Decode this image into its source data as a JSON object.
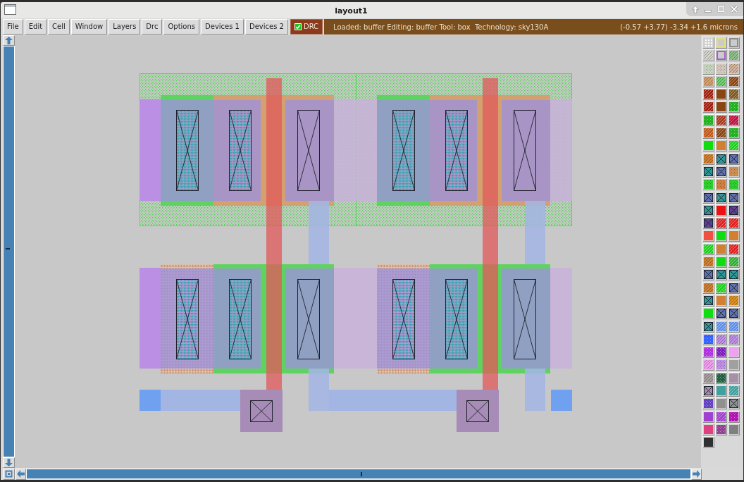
{
  "window": {
    "title": "layout1"
  },
  "menu_bar": [
    "File",
    "Edit",
    "Cell",
    "Window",
    "Layers",
    "Drc",
    "Options",
    "Devices 1",
    "Devices 2"
  ],
  "drc_toggle": {
    "label": "DRC",
    "checked": true
  },
  "status_bar": {
    "info": "Loaded: buffer Editing: buffer Tool: box  Technology: sky130A",
    "coordinates": "(-0.57 +3.77) -3.34 +1.6 microns"
  },
  "layer_palette": [
    {
      "kind": "grid",
      "color": "#d2d2d2"
    },
    {
      "kind": "outline",
      "color": "#e0e080"
    },
    {
      "kind": "outline",
      "color": "#8c8c8c"
    },
    {
      "kind": "stripes",
      "color": "#d4d4cc"
    },
    {
      "kind": "outline",
      "color": "#a060d0"
    },
    {
      "kind": "stripes",
      "color": "#8fbf8a"
    },
    {
      "kind": "dots",
      "color": "#c8d4c0"
    },
    {
      "kind": "dots",
      "color": "#d4c8bc"
    },
    {
      "kind": "stripes",
      "color": "#d4b49c"
    },
    {
      "kind": "stripes",
      "color": "#d8a070"
    },
    {
      "kind": "stripes",
      "color": "#70d070"
    },
    {
      "kind": "stripes",
      "color": "#8b4513"
    },
    {
      "kind": "stripes",
      "color": "#a02010"
    },
    {
      "kind": "solid",
      "color": "#8b4513"
    },
    {
      "kind": "stripes",
      "color": "#7a5a20"
    },
    {
      "kind": "stripes",
      "color": "#a02010"
    },
    {
      "kind": "solid",
      "color": "#8b4513"
    },
    {
      "kind": "dots",
      "color": "#20b020"
    },
    {
      "kind": "dots",
      "color": "#20b020"
    },
    {
      "kind": "stripes",
      "color": "#a83a20"
    },
    {
      "kind": "stripes",
      "color": "#c01040"
    },
    {
      "kind": "stripes",
      "color": "#c05818"
    },
    {
      "kind": "stripes",
      "color": "#8b4513"
    },
    {
      "kind": "dots",
      "color": "#20b020"
    },
    {
      "kind": "solid",
      "color": "#10dd10"
    },
    {
      "kind": "solid",
      "color": "#d08030"
    },
    {
      "kind": "stripes",
      "color": "#20d020"
    },
    {
      "kind": "stripes",
      "color": "#d08030"
    },
    {
      "kind": "cross",
      "color": "#309898"
    },
    {
      "kind": "cross",
      "color": "#6070b0"
    },
    {
      "kind": "cross",
      "color": "#309898"
    },
    {
      "kind": "cross",
      "color": "#6070b0"
    },
    {
      "kind": "dots",
      "color": "#d09050"
    },
    {
      "kind": "dots",
      "color": "#30d030"
    },
    {
      "kind": "dots",
      "color": "#d08040"
    },
    {
      "kind": "dots",
      "color": "#30d030"
    },
    {
      "kind": "cross",
      "color": "#6070b0"
    },
    {
      "kind": "cross",
      "color": "#309898"
    },
    {
      "kind": "cross",
      "color": "#6070b0"
    },
    {
      "kind": "cross",
      "color": "#309898"
    },
    {
      "kind": "solid",
      "color": "#ee1010"
    },
    {
      "kind": "cross",
      "color": "#604090"
    },
    {
      "kind": "cross",
      "color": "#604090"
    },
    {
      "kind": "stripes",
      "color": "#e02020"
    },
    {
      "kind": "stripes",
      "color": "#e02020"
    },
    {
      "kind": "solid",
      "color": "#f05040"
    },
    {
      "kind": "solid",
      "color": "#10dd10"
    },
    {
      "kind": "solid",
      "color": "#d08030"
    },
    {
      "kind": "stripes",
      "color": "#20d020"
    },
    {
      "kind": "solid",
      "color": "#d08030"
    },
    {
      "kind": "stripes",
      "color": "#e02020"
    },
    {
      "kind": "stripes",
      "color": "#d08030"
    },
    {
      "kind": "solid",
      "color": "#10dd10"
    },
    {
      "kind": "stripes",
      "color": "#30b030"
    },
    {
      "kind": "cross",
      "color": "#6070b0"
    },
    {
      "kind": "cross",
      "color": "#309898"
    },
    {
      "kind": "cross",
      "color": "#309898"
    },
    {
      "kind": "stripes",
      "color": "#d08030"
    },
    {
      "kind": "stripes",
      "color": "#20d020"
    },
    {
      "kind": "cross",
      "color": "#6070b0"
    },
    {
      "kind": "cross",
      "color": "#309898"
    },
    {
      "kind": "solid",
      "color": "#d08030"
    },
    {
      "kind": "stripes",
      "color": "#e09020"
    },
    {
      "kind": "solid",
      "color": "#10dd10"
    },
    {
      "kind": "cross",
      "color": "#6070b0"
    },
    {
      "kind": "cross",
      "color": "#6070b0"
    },
    {
      "kind": "cross",
      "color": "#309898"
    },
    {
      "kind": "stripes",
      "color": "#6090e8"
    },
    {
      "kind": "stripes",
      "color": "#6090e8"
    },
    {
      "kind": "dots",
      "color": "#3060ff"
    },
    {
      "kind": "stripes",
      "color": "#c090e8"
    },
    {
      "kind": "stripes",
      "color": "#c090e8"
    },
    {
      "kind": "dots",
      "color": "#b030e0"
    },
    {
      "kind": "dots",
      "color": "#8020c0"
    },
    {
      "kind": "solid",
      "color": "#f0a0f0"
    },
    {
      "kind": "stripes",
      "color": "#f0a0f0"
    },
    {
      "kind": "dots",
      "color": "#c090e8"
    },
    {
      "kind": "solid",
      "color": "#a0a0a0"
    },
    {
      "kind": "stripes",
      "color": "#a8a0a0"
    },
    {
      "kind": "dots",
      "color": "#206040"
    },
    {
      "kind": "solid",
      "color": "#a890a8"
    },
    {
      "kind": "cross",
      "color": "#a890a8"
    },
    {
      "kind": "solid",
      "color": "#40a0a0"
    },
    {
      "kind": "stripes",
      "color": "#40a0a0"
    },
    {
      "kind": "dots",
      "color": "#6040c0"
    },
    {
      "kind": "solid",
      "color": "#909090"
    },
    {
      "kind": "cross",
      "color": "#909090"
    },
    {
      "kind": "solid",
      "color": "#a040d0"
    },
    {
      "kind": "stripes",
      "color": "#a040d0"
    },
    {
      "kind": "dots",
      "color": "#b010b0"
    },
    {
      "kind": "solid",
      "color": "#e04080"
    },
    {
      "kind": "dots",
      "color": "#904090"
    },
    {
      "kind": "solid",
      "color": "#808080"
    },
    {
      "kind": "solid",
      "color": "#303030"
    }
  ]
}
